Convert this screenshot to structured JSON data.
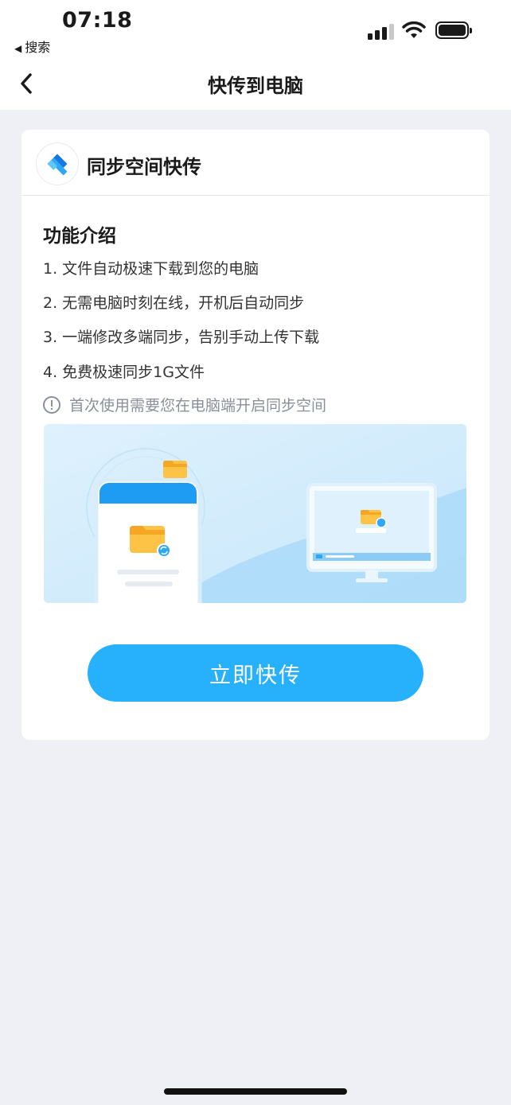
{
  "status_bar": {
    "time": "07:18",
    "back_app": "搜索"
  },
  "nav": {
    "title": "快传到电脑"
  },
  "card": {
    "title": "同步空间快传",
    "section_title": "功能介绍",
    "features": [
      "1. 文件自动极速下载到您的电脑",
      "2. 无需电脑时刻在线，开机后自动同步",
      "3. 一端修改多端同步，告别手动上传下载",
      "4. 免费极速同步1G文件"
    ],
    "notice": "首次使用需要您在电脑端开启同步空间",
    "cta_label": "立即快传"
  },
  "colors": {
    "accent": "#27b0fb",
    "background": "#eef0f5",
    "notice_text": "#8a8f99"
  }
}
